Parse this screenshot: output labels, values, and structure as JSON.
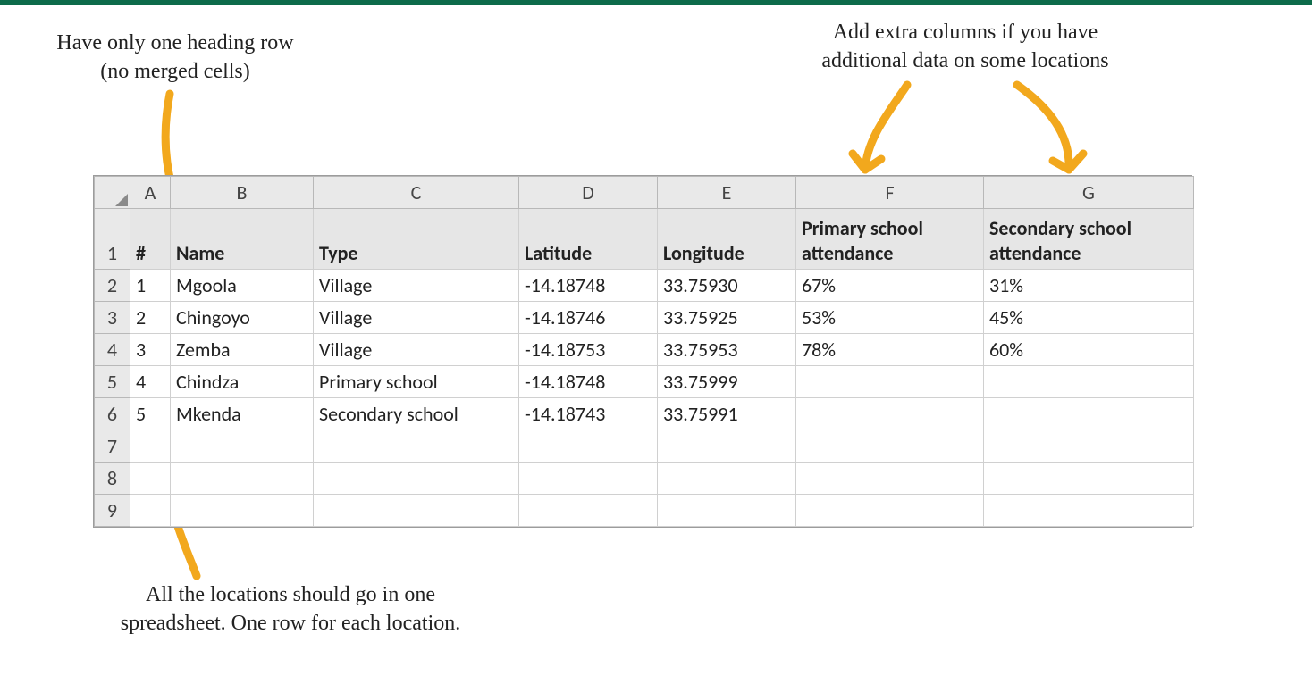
{
  "annotations": {
    "top_left": "Have only one heading row\n(no merged cells)",
    "top_right": "Add extra columns if you have\nadditional data on some locations",
    "bottom": "All the locations should go in one\nspreadsheet. One row for each location."
  },
  "col_letters": [
    "A",
    "B",
    "C",
    "D",
    "E",
    "F",
    "G"
  ],
  "row_numbers": [
    "1",
    "2",
    "3",
    "4",
    "5",
    "6",
    "7",
    "8",
    "9"
  ],
  "headers": {
    "num": "#",
    "name": "Name",
    "type": "Type",
    "lat": "Latitude",
    "lon": "Longitude",
    "primary": "Primary school attendance",
    "secondary": "Secondary school attendance"
  },
  "rows": [
    {
      "n": "1",
      "name": "Mgoola",
      "type": "Village",
      "lat": "-14.18748",
      "lon": "33.75930",
      "p": "67%",
      "s": "31%"
    },
    {
      "n": "2",
      "name": "Chingoyo",
      "type": "Village",
      "lat": "-14.18746",
      "lon": "33.75925",
      "p": "53%",
      "s": "45%"
    },
    {
      "n": "3",
      "name": "Zemba",
      "type": "Village",
      "lat": "-14.18753",
      "lon": "33.75953",
      "p": "78%",
      "s": "60%"
    },
    {
      "n": "4",
      "name": "Chindza",
      "type": "Primary school",
      "lat": "-14.18748",
      "lon": "33.75999",
      "p": "",
      "s": ""
    },
    {
      "n": "5",
      "name": "Mkenda",
      "type": "Secondary school",
      "lat": "-14.18743",
      "lon": "33.75991",
      "p": "",
      "s": ""
    }
  ]
}
